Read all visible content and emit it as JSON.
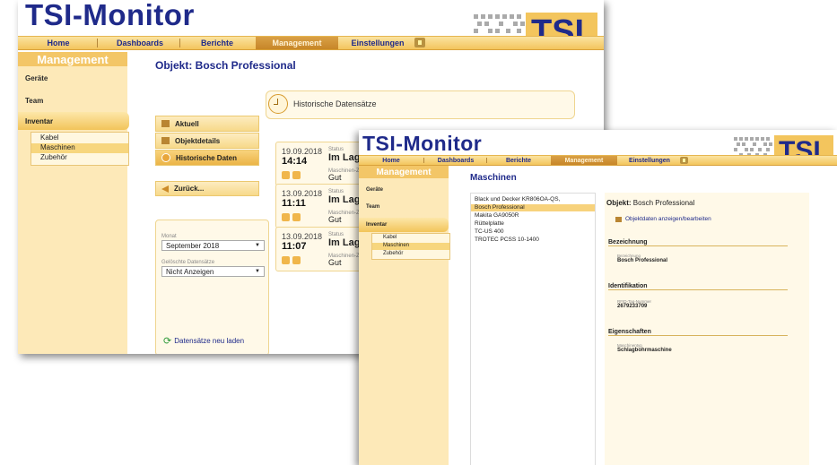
{
  "back_window": {
    "brand": "TSI-Monitor",
    "logo": "TSI",
    "nav": [
      "Home",
      "Dashboards",
      "Berichte",
      "Management",
      "Einstellungen"
    ],
    "nav_active": "Management",
    "sidebar": {
      "header": "Management",
      "items": [
        "Geräte",
        "Team",
        "Inventar"
      ],
      "active": "Inventar",
      "subitems": [
        "Kabel",
        "Maschinen",
        "Zubehör"
      ],
      "sub_selected": "Maschinen"
    },
    "page_title": "Objekt: Bosch Professional",
    "actions": [
      {
        "label": "Aktuell",
        "icon": "box-icon"
      },
      {
        "label": "Objektdetails",
        "icon": "box-icon"
      },
      {
        "label": "Historische Daten",
        "icon": "clock-icon"
      }
    ],
    "actions_active": "Historische Daten",
    "back_label": "Zurück...",
    "filter": {
      "month_label": "Monat",
      "month_value": "September 2018",
      "deleted_label": "Gelöschte Datensätze",
      "deleted_value": "Nicht Anzeigen"
    },
    "reload_label": "Datensätze neu laden",
    "history_title": "Historische Datensätze",
    "records": [
      {
        "date": "19.09.2018",
        "time": "14:14",
        "status_label": "Status",
        "status": "Im Lager",
        "machine_label": "Maschinen-Z...",
        "machine": "Gut"
      },
      {
        "date": "13.09.2018",
        "time": "11:11",
        "status_label": "Status",
        "status": "Im Lager",
        "machine_label": "Maschinen-Z...",
        "machine": "Gut"
      },
      {
        "date": "13.09.2018",
        "time": "11:07",
        "status_label": "Status",
        "status": "Im Lager",
        "machine_label": "Maschinen-Z...",
        "machine": "Gut"
      }
    ]
  },
  "front_window": {
    "brand": "TSI-Monitor",
    "logo": "TSI",
    "nav": [
      "Home",
      "Dashboards",
      "Berichte",
      "Management",
      "Einstellungen"
    ],
    "nav_active": "Management",
    "sidebar": {
      "header": "Management",
      "items": [
        "Geräte",
        "Team",
        "Inventar"
      ],
      "active": "Inventar",
      "subitems": [
        "Kabel",
        "Maschinen",
        "Zubehör"
      ],
      "sub_selected": "Maschinen"
    },
    "page_title": "Maschinen",
    "machines": [
      "Black und Decker KR806OA-QS,",
      "Bosch Professional",
      "Makita GA9050R",
      "Rüttelplatte",
      "TC-US 400",
      "TROTEC PCSS 10-1400"
    ],
    "machines_selected": "Bosch Professional",
    "detail": {
      "object_prefix": "Objekt:",
      "object_name": "Bosch Professional",
      "edit_link": "Objektdaten anzeigen/bearbeiten",
      "sections": [
        {
          "title": "Bezeichnung",
          "field_label": "Bezeichnung",
          "field_value": "Bosch Professional"
        },
        {
          "title": "Identifikation",
          "field_label": "RFID-Tag-Nummer",
          "field_value": "2679233709"
        },
        {
          "title": "Eigenschaften",
          "field_label": "Maschinentyp",
          "field_value": "Schlagbohrmaschine"
        }
      ]
    }
  },
  "colors": {
    "brand_blue": "#1f2a8a",
    "accent_orange": "#f3c55d",
    "sidebar_bg": "#fde9b8"
  }
}
